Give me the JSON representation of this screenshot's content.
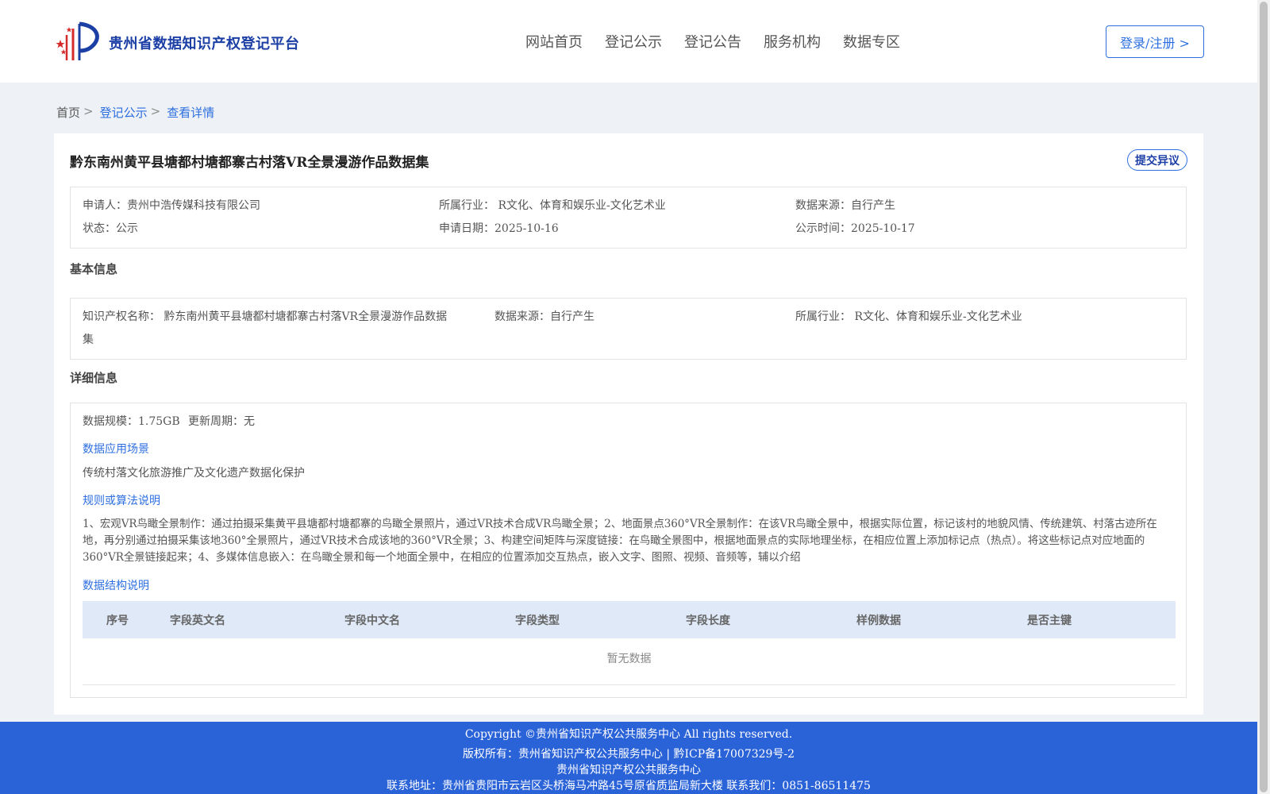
{
  "header": {
    "logo_text": "贵州省数据知识产权登记平台",
    "nav": [
      "网站首页",
      "登记公示",
      "登记公告",
      "服务机构",
      "数据专区"
    ],
    "login_label": "登录/注册 >"
  },
  "breadcrumb": {
    "home": "首页",
    "sep": ">",
    "level1": "登记公示",
    "current": "查看详情"
  },
  "detail": {
    "title": "黔东南州黄平县塘都村塘都寨古村落VR全景漫游作品数据集",
    "objection_label": "提交异议",
    "summary": {
      "applicant": "申请人：贵州中浩传媒科技有限公司",
      "industry": "所属行业： R文化、体育和娱乐业-文化艺术业",
      "source": "数据来源：自行产生",
      "status": "状态：公示",
      "apply_date": "申请日期：2025-10-16",
      "publish_date": "公示时间：2025-10-17"
    },
    "basic_title": "基本信息",
    "basic": {
      "ip_name_line1": "知识产权名称： 黔东南州黄平县塘都村塘都寨古村落VR全景漫游作品数据",
      "ip_name_line2": "集",
      "source": "数据来源：自行产生",
      "industry": "所属行业： R文化、体育和娱乐业-文化艺术业"
    },
    "detail_title": "详细信息",
    "scale": "数据规模：1.75GB",
    "update": "更新周期：无",
    "scene_label": "数据应用场景",
    "scene_text": "传统村落文化旅游推广及文化遗产数据化保护",
    "rule_label": "规则或算法说明",
    "rule_text": "1、宏观VR鸟瞰全景制作：通过拍摄采集黄平县塘都村塘都寨的鸟瞰全景照片，通过VR技术合成VR鸟瞰全景；2、地面景点360°VR全景制作：在该VR鸟瞰全景中，根据实际位置，标记该村的地貌风情、传统建筑、村落古迹所在地，再分别通过拍摄采集该地360°全景照片，通过VR技术合成该地的360°VR全景；3、构建空间矩阵与深度链接：在鸟瞰全景图中，根据地面景点的实际地理坐标，在相应位置上添加标记点（热点）。将这些标记点对应地面的360°VR全景链接起来；4、多媒体信息嵌入：在鸟瞰全景和每一个地面全景中，在相应的位置添加交互热点，嵌入文字、图照、视频、音频等，辅以介绍",
    "structure_label": "数据结构说明",
    "table_headers": [
      "序号",
      "字段英文名",
      "字段中文名",
      "字段类型",
      "字段长度",
      "样例数据",
      "是否主键"
    ],
    "table_empty": "暂无数据"
  },
  "footer": {
    "line1": "Copyright ©贵州省知识产权公共服务中心 All rights reserved.",
    "line2": "版权所有：贵州省知识产权公共服务中心 | 黔ICP备17007329号-2",
    "line3": "贵州省知识产权公共服务中心",
    "line4": "联系地址：贵州省贵阳市云岩区头桥海马冲路45号原省质监局新大楼 联系我们：0851-86511475"
  }
}
